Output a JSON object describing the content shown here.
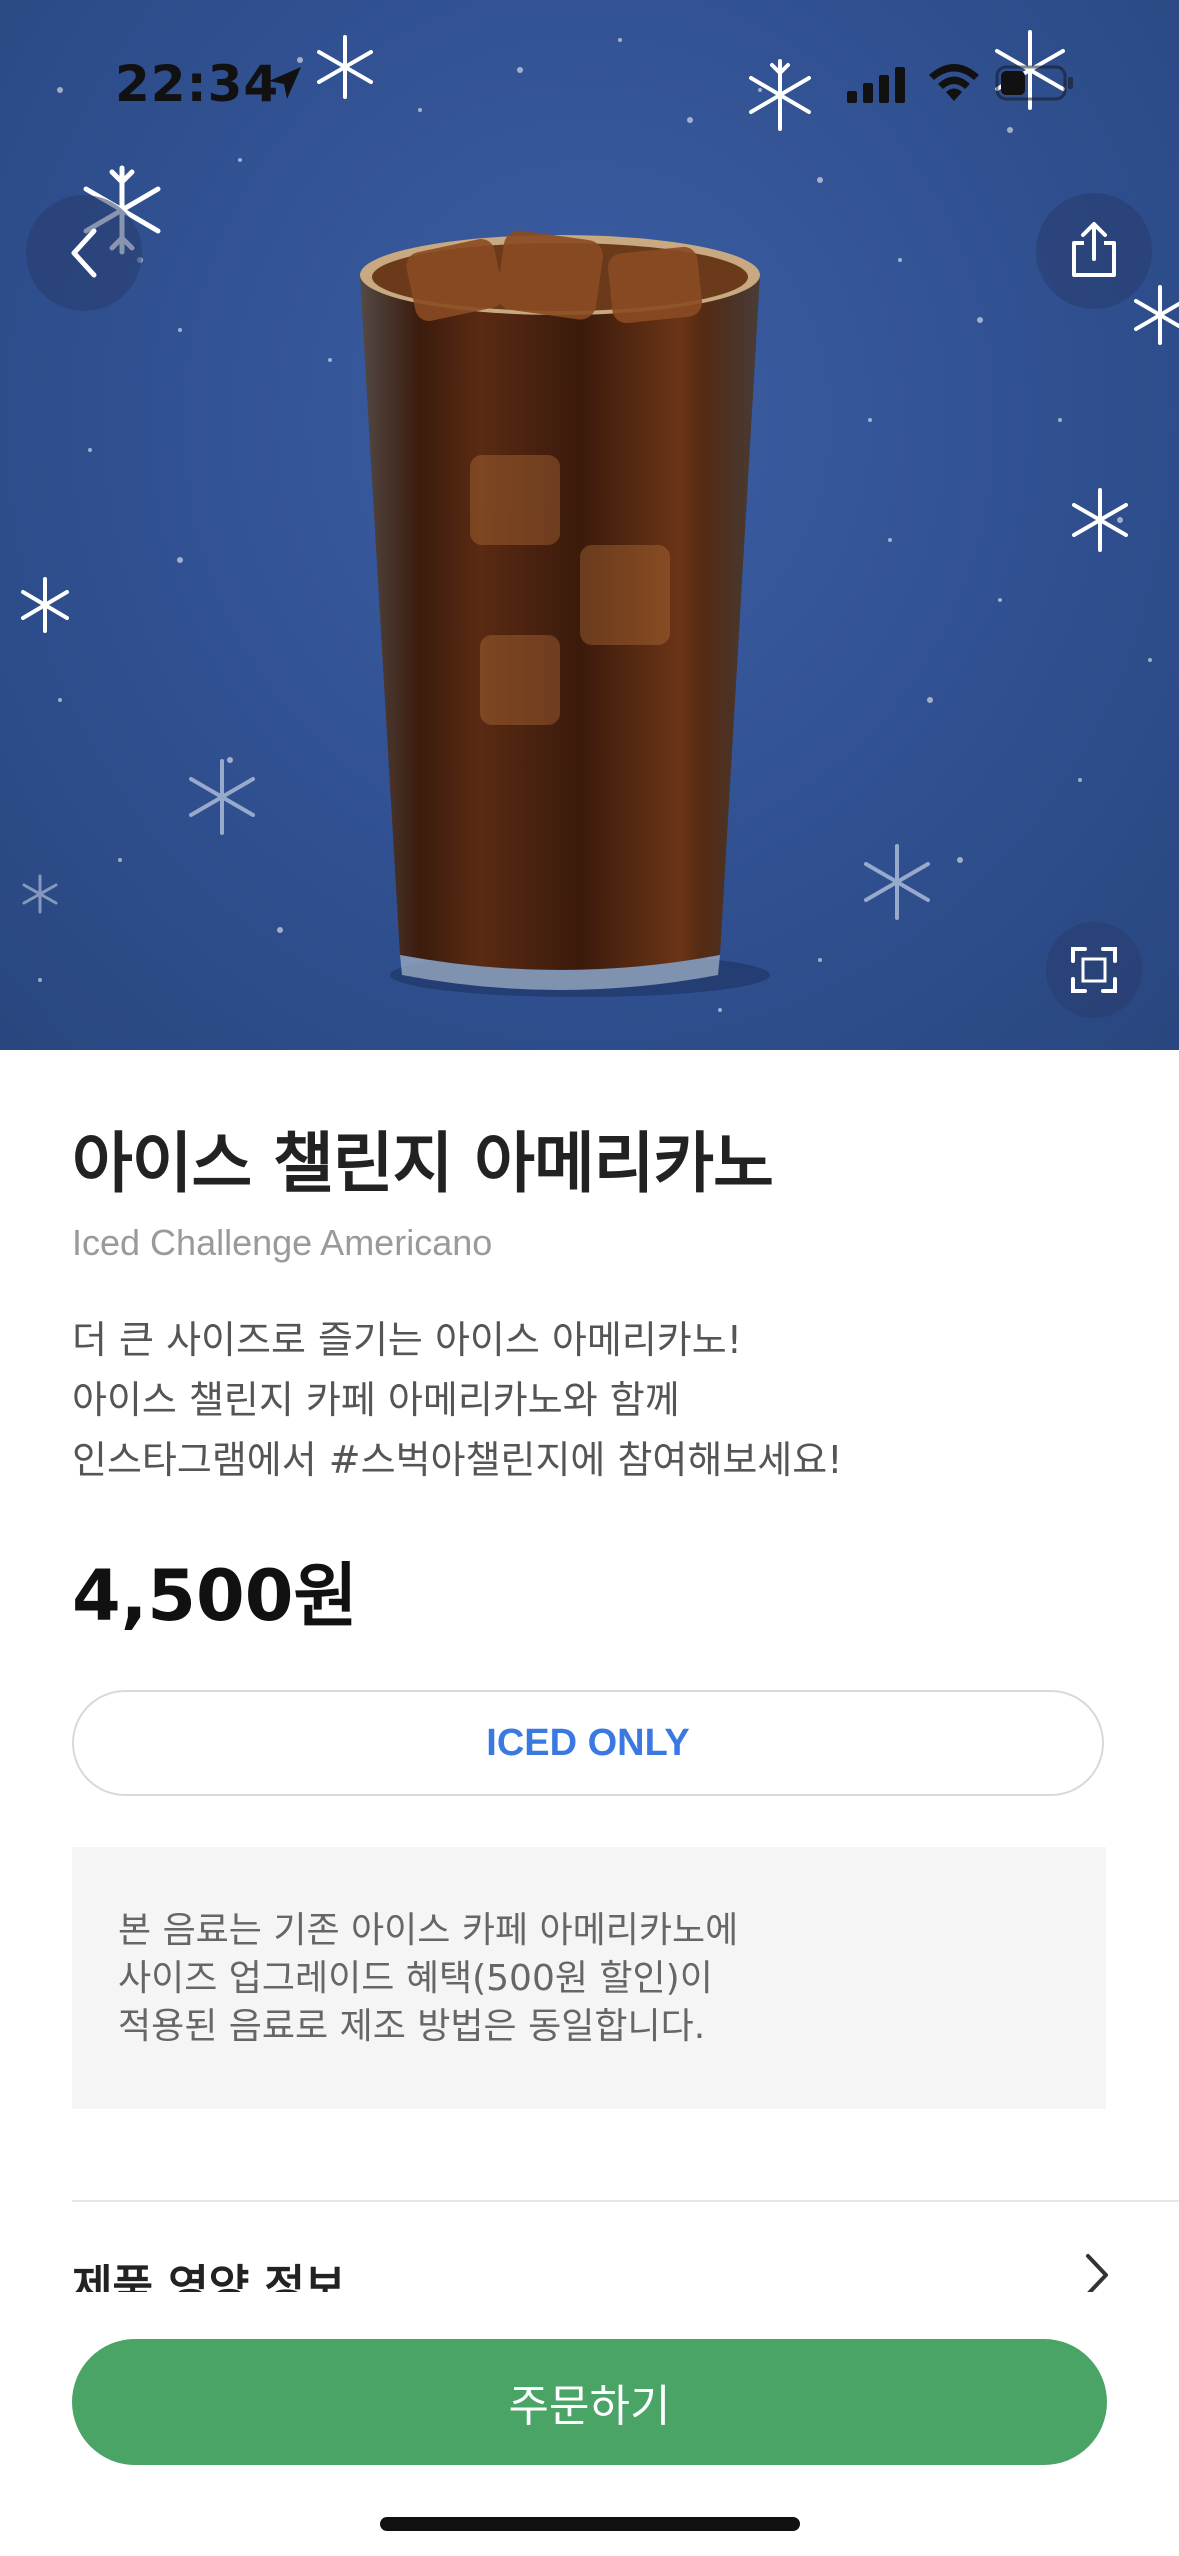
{
  "status_bar": {
    "time": "22:34"
  },
  "product": {
    "name_ko": "아이스 챌린지 아메리카노",
    "name_en": "Iced Challenge Americano",
    "description_lines": [
      "더 큰 사이즈로 즐기는 아이스 아메리카노!",
      "아이스 챌린지 카페 아메리카노와 함께",
      "인스타그램에서 #스벅아챌린지에 참여해보세요!"
    ],
    "price": "4,500원",
    "temperature_option": "ICED ONLY",
    "notice_lines": [
      "본 음료는 기존 아이스 카페 아메리카노에",
      "사이즈 업그레이드 혜택(500원 할인)이",
      "적용된 음료로 제조 방법은 동일합니다."
    ]
  },
  "sections": {
    "nutrition_label": "제품 영양 정보"
  },
  "actions": {
    "order_label": "주문하기"
  },
  "colors": {
    "hero_background": "#2f4f8f",
    "accent_blue": "#3a79e2",
    "order_green": "#4aa466"
  }
}
